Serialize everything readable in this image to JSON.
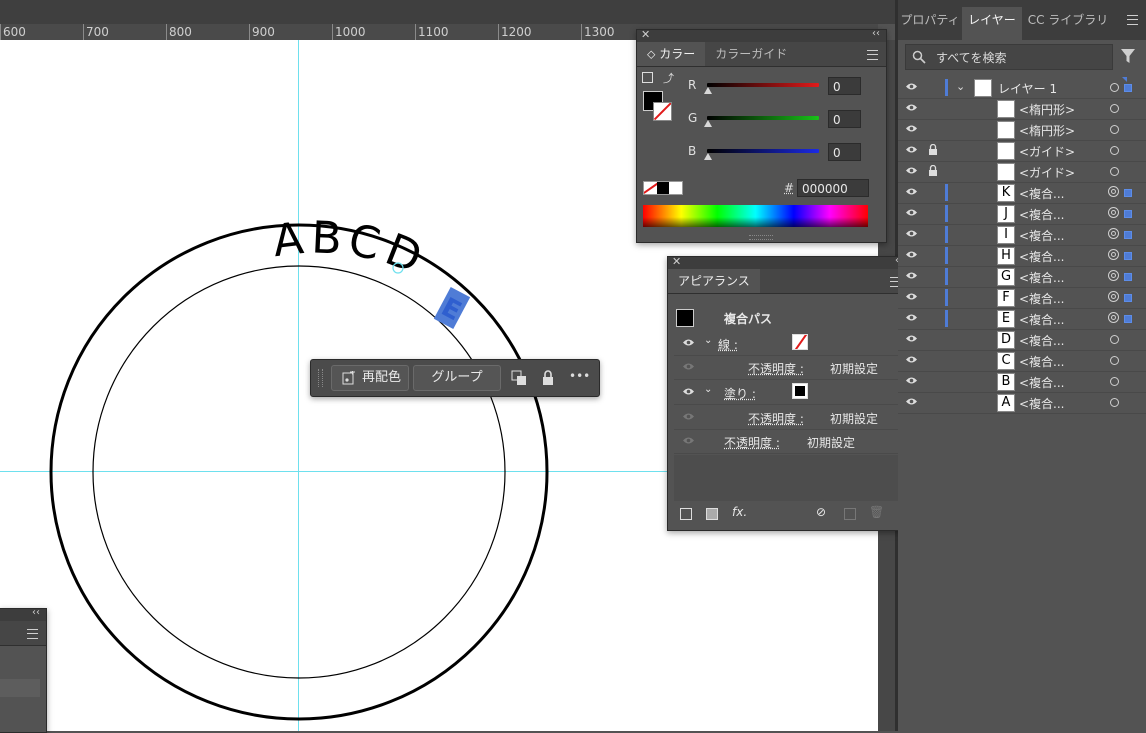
{
  "ruler": {
    "ticks": [
      {
        "label": "600"
      },
      {
        "label": "700"
      },
      {
        "label": "800"
      },
      {
        "label": "900"
      },
      {
        "label": "1000"
      },
      {
        "label": "1100"
      },
      {
        "label": "1200"
      },
      {
        "label": "1300"
      }
    ]
  },
  "artboard": {
    "arc_text": "ABCD",
    "selected_glyph": "E"
  },
  "context_toolbar": {
    "recolor_label": "再配色",
    "group_label": "グループ",
    "more_label": "•••"
  },
  "color_panel": {
    "tabs": [
      "カラー",
      "カラーガイド"
    ],
    "active_tab": 0,
    "channels": [
      {
        "label": "R",
        "value": "0",
        "color": "#e11b1b"
      },
      {
        "label": "G",
        "value": "0",
        "color": "#19c219"
      },
      {
        "label": "B",
        "value": "0",
        "color": "#1b2ae6"
      }
    ],
    "hex_label": "#",
    "hex_value": "000000"
  },
  "appearance_panel": {
    "title": "アピアランス",
    "object_type": "複合パス",
    "stroke_label": "線 :",
    "fill_label": "塗り :",
    "opacity_label": "不透明度 :",
    "opacity_value": "初期設定",
    "fx_label": "fx."
  },
  "right_dock": {
    "tabs": [
      "プロパティ",
      "レイヤー",
      "CC ライブラリ"
    ],
    "active_tab": 1,
    "search_placeholder": "すべてを検索",
    "layers": [
      {
        "name": "レイヤー 1",
        "glyph": "",
        "is_layer": true,
        "locked": false,
        "selected": true,
        "double_target": false
      },
      {
        "name": "<楕円形>",
        "glyph": "",
        "is_layer": false,
        "locked": false,
        "selected": false,
        "double_target": false
      },
      {
        "name": "<楕円形>",
        "glyph": "",
        "is_layer": false,
        "locked": false,
        "selected": false,
        "double_target": false
      },
      {
        "name": "<ガイド>",
        "glyph": "",
        "is_layer": false,
        "locked": true,
        "selected": false,
        "double_target": false
      },
      {
        "name": "<ガイド>",
        "glyph": "",
        "is_layer": false,
        "locked": true,
        "selected": false,
        "double_target": false
      },
      {
        "name": "<複合...",
        "glyph": "K",
        "is_layer": false,
        "locked": false,
        "selected": true,
        "double_target": true
      },
      {
        "name": "<複合...",
        "glyph": "J",
        "is_layer": false,
        "locked": false,
        "selected": true,
        "double_target": true
      },
      {
        "name": "<複合...",
        "glyph": "I",
        "is_layer": false,
        "locked": false,
        "selected": true,
        "double_target": true
      },
      {
        "name": "<複合...",
        "glyph": "H",
        "is_layer": false,
        "locked": false,
        "selected": true,
        "double_target": true
      },
      {
        "name": "<複合...",
        "glyph": "G",
        "is_layer": false,
        "locked": false,
        "selected": true,
        "double_target": true
      },
      {
        "name": "<複合...",
        "glyph": "F",
        "is_layer": false,
        "locked": false,
        "selected": true,
        "double_target": true
      },
      {
        "name": "<複合...",
        "glyph": "E",
        "is_layer": false,
        "locked": false,
        "selected": true,
        "double_target": true
      },
      {
        "name": "<複合...",
        "glyph": "D",
        "is_layer": false,
        "locked": false,
        "selected": false,
        "double_target": false
      },
      {
        "name": "<複合...",
        "glyph": "C",
        "is_layer": false,
        "locked": false,
        "selected": false,
        "double_target": false
      },
      {
        "name": "<複合...",
        "glyph": "B",
        "is_layer": false,
        "locked": false,
        "selected": false,
        "double_target": false
      },
      {
        "name": "<複合...",
        "glyph": "A",
        "is_layer": false,
        "locked": false,
        "selected": false,
        "double_target": false
      }
    ]
  },
  "colors": {
    "selection_blue": "#4f7cd6",
    "guide_cyan": "#6ee0ee",
    "panel_bg": "#535353"
  }
}
